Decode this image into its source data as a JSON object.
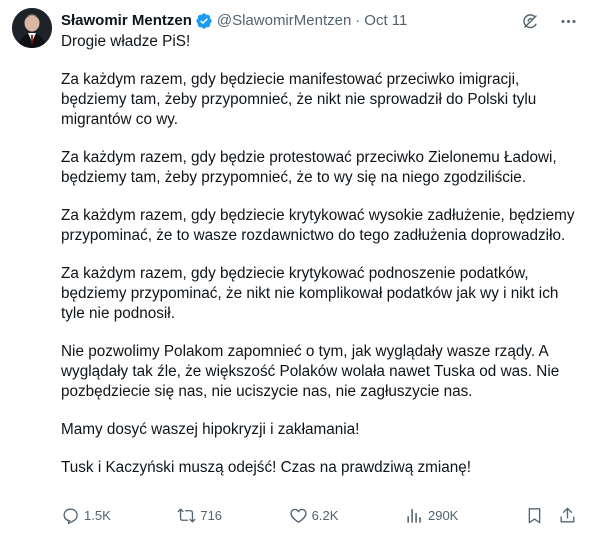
{
  "author": {
    "name": "Sławomir Mentzen",
    "handle": "@SlawomirMentzen",
    "separator": "·",
    "date": "Oct 11"
  },
  "tweet": {
    "paragraphs": [
      "Drogie władze PiS!",
      "Za każdym razem, gdy będziecie manifestować przeciwko imigracji, będziemy tam, żeby przypomnieć, że nikt nie sprowadził do Polski tylu migrantów co wy.",
      "Za każdym razem, gdy będzie protestować przeciwko Zielonemu Ładowi, będziemy tam, żeby przypomnieć, że to wy się na niego zgodziliście.",
      "Za każdym razem, gdy będziecie krytykować wysokie zadłużenie, będziemy przypominać, że to wasze rozdawnictwo do tego zadłużenia doprowadziło.",
      "Za każdym razem, gdy będziecie krytykować podnoszenie podatków, będziemy przypominać, że nikt nie komplikował podatków jak wy i nikt ich tyle nie podnosił.",
      "Nie pozwolimy Polakom zapomnieć o tym, jak wyglądały wasze rządy. A wyglądały tak źle, że większość Polaków wolała nawet Tuska od was. Nie pozbędziecie się nas, nie uciszycie nas, nie zagłuszycie nas.",
      "Mamy dosyć waszej hipokryzji i zakłamania!",
      "Tusk i Kaczyński muszą odejść! Czas na prawdziwą zmianę!"
    ]
  },
  "metrics": {
    "replies": "1.5K",
    "reposts": "716",
    "likes": "6.2K",
    "views": "290K"
  },
  "icons": {
    "verified": "verified-badge-icon",
    "grok": "grok-icon",
    "more": "more-icon",
    "reply": "reply-icon",
    "repost": "repost-icon",
    "like": "like-icon",
    "views": "views-icon",
    "bookmark": "bookmark-icon",
    "share": "share-icon"
  },
  "colors": {
    "verified": "#1d9bf0",
    "text": "#0f1419",
    "muted": "#536471"
  }
}
